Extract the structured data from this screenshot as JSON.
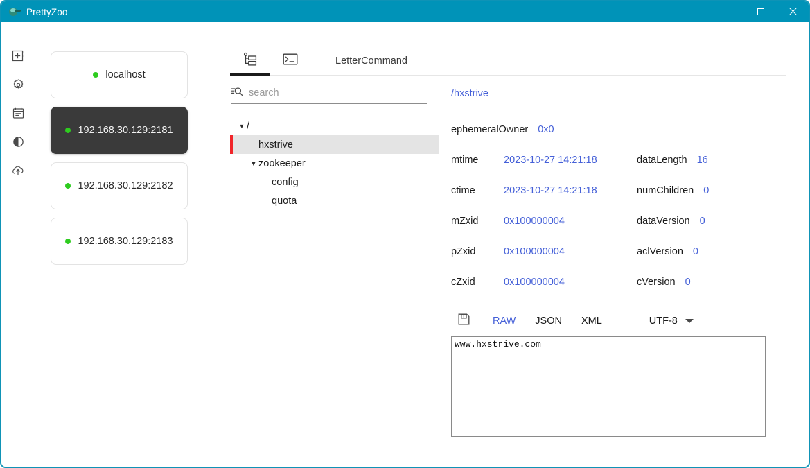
{
  "window": {
    "title": "PrettyZoo",
    "accent_color": "#0093b8",
    "controls": {
      "minimize": "minimize-button",
      "maximize": "maximize-button",
      "close": "close-button"
    }
  },
  "rail": {
    "items": [
      {
        "name": "add-server-icon",
        "label": "Add"
      },
      {
        "name": "settings-gear-icon",
        "label": "Settings"
      },
      {
        "name": "clipboard-notes-icon",
        "label": "Notes"
      },
      {
        "name": "theme-contrast-icon",
        "label": "Theme"
      },
      {
        "name": "cloud-upload-icon",
        "label": "Export"
      }
    ]
  },
  "servers": {
    "status_dot_color": "#2ecc1f",
    "items": [
      {
        "label": "localhost",
        "selected": false
      },
      {
        "label": "192.168.30.129:2181",
        "selected": true
      },
      {
        "label": "192.168.30.129:2182",
        "selected": false
      },
      {
        "label": "192.168.30.129:2183",
        "selected": false
      }
    ]
  },
  "tabs": [
    {
      "name": "tab-node-tree",
      "icon": "tree-hierarchy-icon",
      "label": "",
      "active": true
    },
    {
      "name": "tab-terminal",
      "icon": "terminal-icon",
      "label": "",
      "active": false
    },
    {
      "name": "tab-letter-command",
      "icon": "",
      "label": "LetterCommand",
      "active": false
    }
  ],
  "search": {
    "placeholder": "search",
    "value": "",
    "icon": "search-filter-icon"
  },
  "tree": {
    "selected_accent": "#f1252a",
    "nodes": [
      {
        "label": "/",
        "indent": 0,
        "expanded": true,
        "hasChildren": true,
        "selected": false
      },
      {
        "label": "hxstrive",
        "indent": 1,
        "expanded": false,
        "hasChildren": false,
        "selected": true
      },
      {
        "label": "zookeeper",
        "indent": 1,
        "expanded": true,
        "hasChildren": true,
        "selected": false
      },
      {
        "label": "config",
        "indent": 2,
        "expanded": false,
        "hasChildren": false,
        "selected": false
      },
      {
        "label": "quota",
        "indent": 2,
        "expanded": false,
        "hasChildren": false,
        "selected": false
      }
    ]
  },
  "detail": {
    "path": "/hxstrive",
    "rows": [
      {
        "left": {
          "key": "ephemeralOwner",
          "value": "0x0"
        },
        "right": {
          "key": "",
          "value": ""
        }
      },
      {
        "left": {
          "key": "mtime",
          "value": "2023-10-27 14:21:18"
        },
        "right": {
          "key": "dataLength",
          "value": "16"
        }
      },
      {
        "left": {
          "key": "ctime",
          "value": "2023-10-27 14:21:18"
        },
        "right": {
          "key": "numChildren",
          "value": "0"
        }
      },
      {
        "left": {
          "key": "mZxid",
          "value": "0x100000004"
        },
        "right": {
          "key": "dataVersion",
          "value": "0"
        }
      },
      {
        "left": {
          "key": "pZxid",
          "value": "0x100000004"
        },
        "right": {
          "key": "aclVersion",
          "value": "0"
        }
      },
      {
        "left": {
          "key": "cZxid",
          "value": "0x100000004"
        },
        "right": {
          "key": "cVersion",
          "value": "0"
        }
      }
    ]
  },
  "editor": {
    "save_icon": "floppy-save-icon",
    "formats": [
      {
        "label": "RAW",
        "selected": true
      },
      {
        "label": "JSON",
        "selected": false
      },
      {
        "label": "XML",
        "selected": false
      }
    ],
    "encoding": "UTF-8",
    "content": "www.hxstrive.com"
  }
}
